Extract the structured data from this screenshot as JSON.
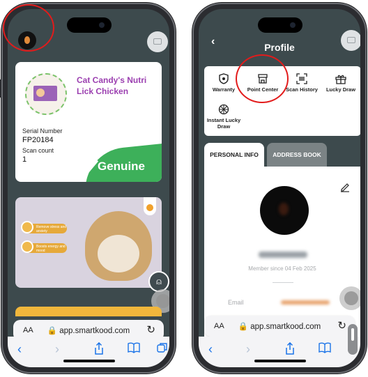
{
  "left_phone": {
    "card": {
      "product_title": "Cat Candy's Nutri Lick Chicken",
      "serial_label": "Serial Number",
      "serial_value": "FP20184",
      "scan_label": "Scan count",
      "scan_value": "1",
      "status": "Genuine"
    },
    "browser": {
      "aa": "AA",
      "url": "app.smartkood.com"
    },
    "banner_pills": [
      "Remove stress and anxiety",
      "Boosts energy and mood"
    ]
  },
  "right_phone": {
    "title": "Profile",
    "features": [
      {
        "label": "Warranty",
        "icon": "shield-icon"
      },
      {
        "label": "Point Center",
        "icon": "store-icon"
      },
      {
        "label": "Scan History",
        "icon": "scan-icon"
      },
      {
        "label": "Lucky Draw",
        "icon": "gift-icon"
      },
      {
        "label": "Instant Lucky Draw",
        "icon": "wheel-icon"
      }
    ],
    "tabs": [
      "PERSONAL INFO",
      "ADDRESS BOOK"
    ],
    "member_since": "Member since 04 Feb 2025",
    "email_label": "Email",
    "browser": {
      "aa": "AA",
      "url": "app.smartkood.com"
    }
  },
  "colors": {
    "screen_bg": "#3d4a4d",
    "accent_red": "#e21b1b",
    "genuine_green": "#3db05a",
    "product_purple": "#9b3fb0",
    "link_blue": "#1a73e8"
  }
}
